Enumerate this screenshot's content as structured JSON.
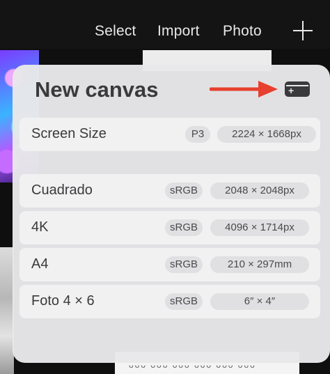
{
  "toolbar": {
    "select_label": "Select",
    "import_label": "Import",
    "photo_label": "Photo",
    "add_icon": "plus-icon"
  },
  "popover": {
    "title": "New canvas",
    "annotation_arrow_color": "#e8402f",
    "new_canvas_icon": "new-canvas-icon",
    "screen_size": {
      "name": "Screen Size",
      "color_space": "P3",
      "dimensions": "2224 × 1668px"
    },
    "presets": [
      {
        "name": "Cuadrado",
        "color_space": "sRGB",
        "dimensions": "2048 × 2048px"
      },
      {
        "name": "4K",
        "color_space": "sRGB",
        "dimensions": "4096 × 1714px"
      },
      {
        "name": "A4",
        "color_space": "sRGB",
        "dimensions": "210 × 297mm"
      },
      {
        "name": "Foto 4 × 6",
        "color_space": "sRGB",
        "dimensions": "6″ × 4″"
      }
    ]
  }
}
